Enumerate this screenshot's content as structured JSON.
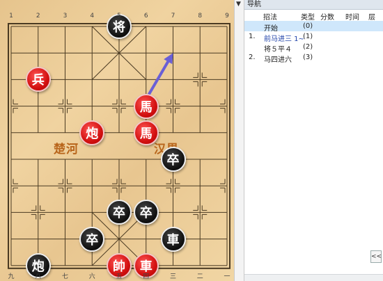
{
  "board": {
    "file_numbers_top": [
      "1",
      "2",
      "3",
      "4",
      "5",
      "6",
      "7",
      "8",
      "9"
    ],
    "file_numbers_bottom": [
      "九",
      "八",
      "七",
      "六",
      "五",
      "四",
      "三",
      "二",
      "一"
    ],
    "river_left": "楚河",
    "river_right": "汉界",
    "pieces": [
      {
        "label": "将",
        "color": "black",
        "file": 4,
        "rank": 0
      },
      {
        "label": "兵",
        "color": "red",
        "file": 1,
        "rank": 2
      },
      {
        "label": "馬",
        "color": "red",
        "file": 5,
        "rank": 3
      },
      {
        "label": "炮",
        "color": "red",
        "file": 3,
        "rank": 4
      },
      {
        "label": "馬",
        "color": "red",
        "file": 5,
        "rank": 4
      },
      {
        "label": "卒",
        "color": "black",
        "file": 6,
        "rank": 5
      },
      {
        "label": "卒",
        "color": "black",
        "file": 4,
        "rank": 7
      },
      {
        "label": "卒",
        "color": "black",
        "file": 5,
        "rank": 7
      },
      {
        "label": "卒",
        "color": "black",
        "file": 3,
        "rank": 8
      },
      {
        "label": "車",
        "color": "black",
        "file": 6,
        "rank": 8
      },
      {
        "label": "炮",
        "color": "black",
        "file": 1,
        "rank": 9
      },
      {
        "label": "帥",
        "color": "red",
        "file": 4,
        "rank": 9
      },
      {
        "label": "車",
        "color": "red",
        "file": 5,
        "rank": 9
      }
    ],
    "arrow": {
      "from_file": 5,
      "from_rank": 3,
      "to_file": 6,
      "to_rank": 1,
      "color": "#6a5fd6"
    }
  },
  "splitter": {
    "arrow": "▼"
  },
  "nav": {
    "title": "导航",
    "headers": {
      "move": "招法",
      "type": "类型",
      "score": "分数",
      "time": "时间",
      "layer": "层"
    },
    "moves": [
      {
        "num": "",
        "move": "开始",
        "type": "(0)",
        "selected": true,
        "blue": false
      },
      {
        "num": "1.",
        "move": "前马进三 1~",
        "type": "(1)",
        "selected": false,
        "blue": true
      },
      {
        "num": "",
        "move": "将５平４",
        "type": "(2)",
        "selected": false,
        "blue": false
      },
      {
        "num": "2.",
        "move": "马四进六",
        "type": "(3)",
        "selected": false,
        "blue": false
      }
    ],
    "button": "<<"
  }
}
